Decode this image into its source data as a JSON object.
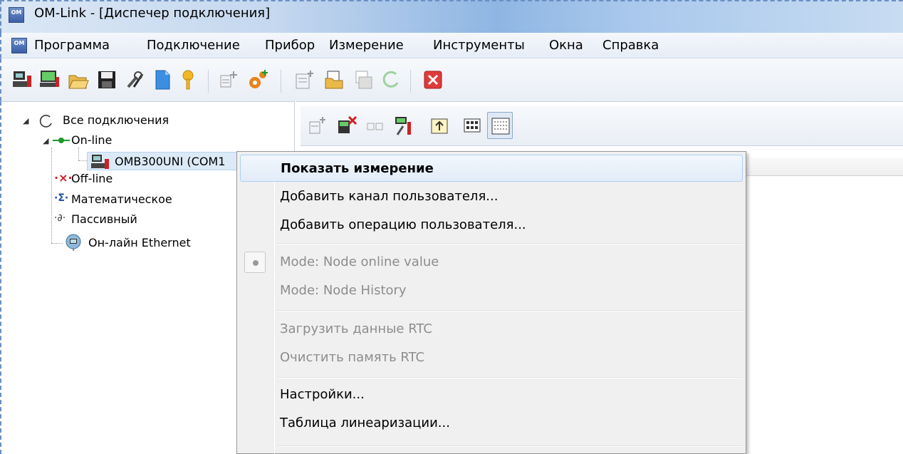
{
  "window": {
    "title": "OM-Link - [Диспечер подключения]",
    "app_icon_text": "OM"
  },
  "menubar": {
    "items": [
      "Программа",
      "Подключение",
      "Прибор",
      "Измерение",
      "Инструменты",
      "Окна",
      "Справка"
    ]
  },
  "toolbar": {
    "icons": [
      "connect-device-icon",
      "device-settings-icon",
      "open-folder-icon",
      "save-icon",
      "tools-icon",
      "document-icon",
      "key-icon",
      "add-channel-icon",
      "add-operation-icon",
      "new-measurement-icon",
      "open-measurement-icon",
      "save-measurement-icon",
      "refresh-icon",
      "close-red-icon"
    ]
  },
  "tree": {
    "root": "Все подключения",
    "online": "On-line",
    "device": "OMB300UNI (COM1",
    "offline": "Off-line",
    "math": "Математическое",
    "passive": "Пассивный",
    "ethernet": "Он-лайн Ethernet"
  },
  "context_menu": {
    "show_measurement": "Показать измерение",
    "add_user_channel": "Добавить канал пользователя...",
    "add_user_operation": "Добавить операцию пользователя...",
    "mode_online": "Mode: Node online value",
    "mode_history": "Mode: Node History",
    "load_rtc": "Загрузить данные RTC",
    "clear_rtc": "Очистить память RTC",
    "settings": "Настройки...",
    "linearization": "Таблица линеаризации..."
  },
  "colors": {
    "highlight": "#e2ecf8",
    "disabled_text": "#8d8d8d",
    "close_red": "#e03a3a"
  }
}
